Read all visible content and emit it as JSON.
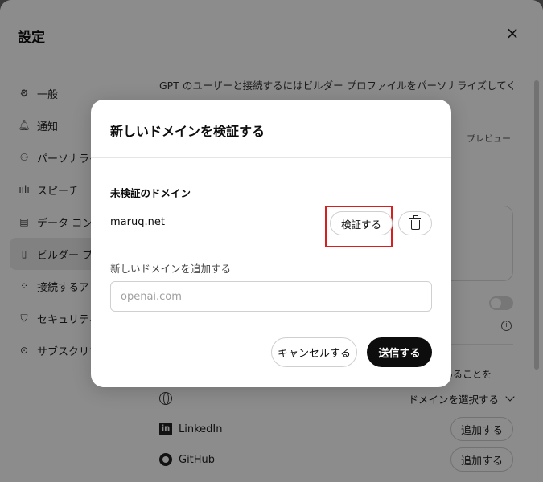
{
  "settings": {
    "title": "設定",
    "sidebar": {
      "items": [
        {
          "label": "一般",
          "icon": "gear-icon"
        },
        {
          "label": "通知",
          "icon": "bell-icon"
        },
        {
          "label": "パーソナライズ",
          "icon": "person-icon"
        },
        {
          "label": "スピーチ",
          "icon": "waveform-icon"
        },
        {
          "label": "データ コントロール",
          "icon": "database-icon"
        },
        {
          "label": "ビルダー プロフィール",
          "icon": "id-card-icon",
          "active": true
        },
        {
          "label": "接続するアプリ",
          "icon": "apps-grid-icon"
        },
        {
          "label": "セキュリティ",
          "icon": "shield-icon"
        },
        {
          "label": "サブスクリプション",
          "icon": "subscription-icon"
        }
      ]
    },
    "main": {
      "intro": "GPT のユーザーと接続するにはビルダー プロファイルをパーソナライズしてください。こ",
      "preview_label": "プレビュー",
      "preview_card_text": "あることを",
      "domain_select": "ドメインを選択する",
      "social": [
        {
          "name": "LinkedIn",
          "icon": "linkedin-icon",
          "action": "追加する"
        },
        {
          "name": "GitHub",
          "icon": "github-icon",
          "action": "追加する"
        }
      ]
    }
  },
  "modal": {
    "title": "新しいドメインを検証する",
    "unverified_label": "未検証のドメイン",
    "domain": "maruq.net",
    "verify_label": "検証する",
    "add_label": "新しいドメインを追加する",
    "input_placeholder": "openai.com",
    "input_value": "",
    "cancel_label": "キャンセルする",
    "send_label": "送信する",
    "highlight_color": "#d61f1f"
  }
}
